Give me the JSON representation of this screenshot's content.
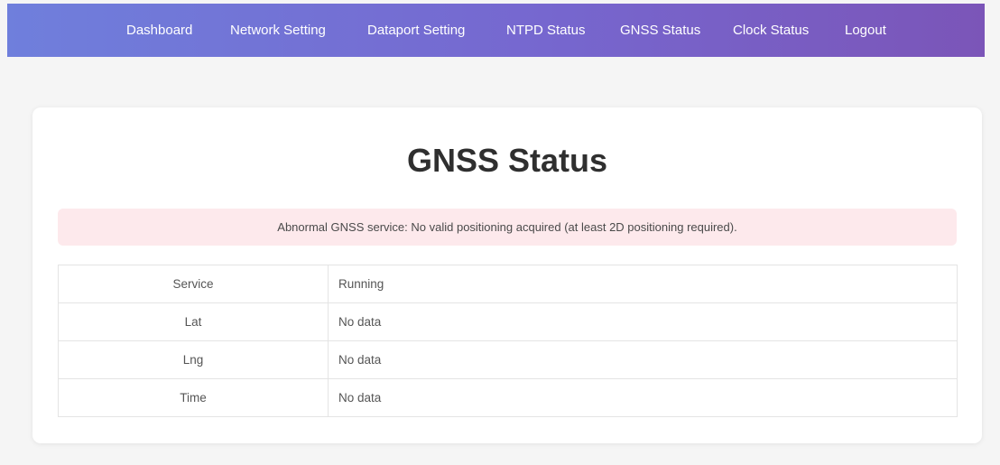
{
  "nav": {
    "items": [
      {
        "label": "Dashboard"
      },
      {
        "label": "Network Setting"
      },
      {
        "label": "Dataport Setting"
      },
      {
        "label": "NTPD Status"
      },
      {
        "label": "GNSS Status"
      },
      {
        "label": "Clock Status"
      },
      {
        "label": "Logout"
      }
    ]
  },
  "page": {
    "title": "GNSS Status"
  },
  "alert": {
    "message": "Abnormal GNSS service: No valid positioning acquired (at least 2D positioning required)."
  },
  "table": {
    "rows": [
      {
        "label": "Service",
        "value": "Running"
      },
      {
        "label": "Lat",
        "value": "No data"
      },
      {
        "label": "Lng",
        "value": "No data"
      },
      {
        "label": "Time",
        "value": "No data"
      }
    ]
  },
  "colors": {
    "nav_gradient_start": "#6f7fdc",
    "nav_gradient_end": "#7b55b8",
    "alert_background": "#fde9ec"
  }
}
